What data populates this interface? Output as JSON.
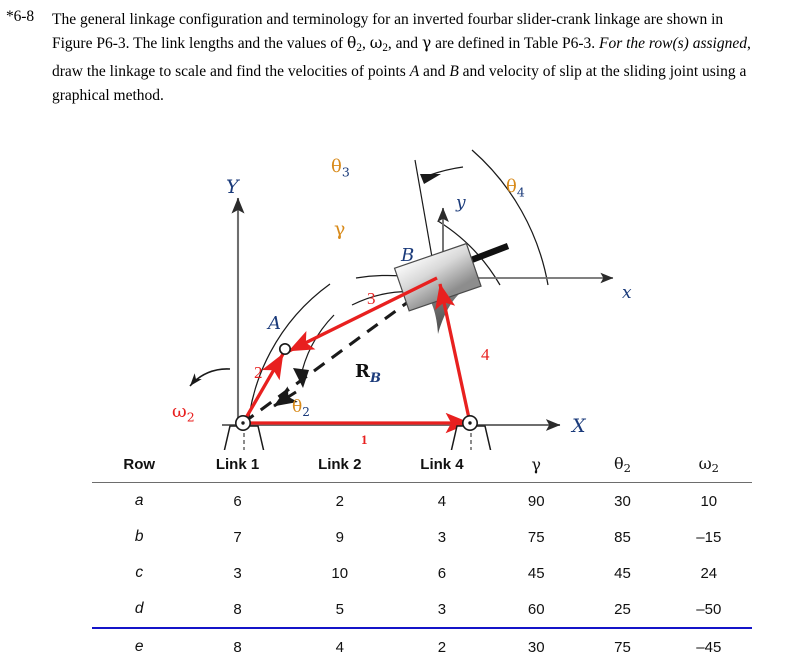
{
  "problem": {
    "number": "*6-8",
    "line1": "The general linkage configuration and terminology for an inverted fourbar slider-crank",
    "line2_a": "linkage are shown in Figure P6-3.  The link lengths and the values of ",
    "line2_theta": "θ",
    "line2_sub2a": "2",
    "line2_b": ", ",
    "line2_omega": "ω",
    "line2_sub2b": "2",
    "line2_c": ", and ",
    "line2_gamma": "γ",
    "line2_d": "  are",
    "line3_a": "defined in Table P6-3. ",
    "line3_italic": "For the row(s) assigned",
    "line3_b": ", draw the linkage to scale and find the",
    "line4_a": "velocities of points ",
    "line4_A": "A",
    "line4_b": " and ",
    "line4_B": "B",
    "line4_c": " and velocity of slip at the sliding joint using a graphical",
    "line5": "method."
  },
  "figure": {
    "labels": {
      "Y_axis": "Y",
      "X_axis": "X",
      "x_axis_local": "x",
      "y_axis_local": "y",
      "point_A": "A",
      "point_B": "B",
      "link1": "1",
      "link2": "2",
      "link3": "3",
      "link4": "4",
      "theta2": "θ",
      "theta2_sub": "2",
      "theta3": "θ",
      "theta3_sub": "3",
      "theta4": "θ",
      "theta4_sub": "4",
      "gamma": "γ",
      "omega2": "ω",
      "omega2_sub": "2",
      "RB_main": "R",
      "RB_sub": "B"
    },
    "colors": {
      "link_red": "#e8201f",
      "label_blue": "#1a3a7a",
      "label_orange": "#d88a1a",
      "axis_gray": "#6e6e6e",
      "black": "#1a1a1a"
    }
  },
  "table": {
    "headers": [
      "Row",
      "Link 1",
      "Link 2",
      "Link 4",
      "γ",
      "θ₂",
      "ω₂"
    ],
    "header_plain": {
      "row": "Row",
      "link1": "Link 1",
      "link2": "Link 2",
      "link4": "Link 4",
      "gamma": "γ",
      "theta2": "θ",
      "theta2_sub": "2",
      "omega2": "ω",
      "omega2_sub": "2"
    },
    "rows": [
      {
        "row": "a",
        "link1": "6",
        "link2": "2",
        "link4": "4",
        "gamma": "90",
        "theta2": "30",
        "omega2": "10"
      },
      {
        "row": "b",
        "link1": "7",
        "link2": "9",
        "link4": "3",
        "gamma": "75",
        "theta2": "85",
        "omega2": "–15"
      },
      {
        "row": "c",
        "link1": "3",
        "link2": "10",
        "link4": "6",
        "gamma": "45",
        "theta2": "45",
        "omega2": "24"
      },
      {
        "row": "d",
        "link1": "8",
        "link2": "5",
        "link4": "3",
        "gamma": "60",
        "theta2": "25",
        "omega2": "–50"
      },
      {
        "row": "e",
        "link1": "8",
        "link2": "4",
        "link4": "2",
        "gamma": "30",
        "theta2": "75",
        "omega2": "–45"
      }
    ],
    "highlight_rule_color": "#1414c8",
    "highlight_after_row_index": 3
  }
}
